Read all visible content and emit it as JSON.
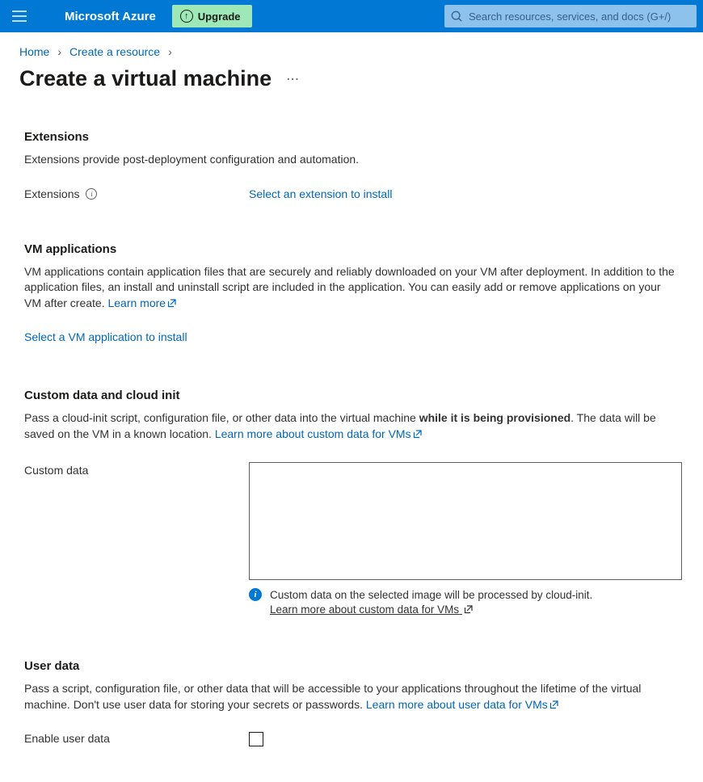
{
  "header": {
    "brand": "Microsoft Azure",
    "upgrade_label": "Upgrade",
    "search_placeholder": "Search resources, services, and docs (G+/)"
  },
  "breadcrumb": {
    "items": [
      "Home",
      "Create a resource"
    ]
  },
  "title": "Create a virtual machine",
  "extensions": {
    "heading": "Extensions",
    "description": "Extensions provide post-deployment configuration and automation.",
    "label": "Extensions",
    "action": "Select an extension to install"
  },
  "vm_apps": {
    "heading": "VM applications",
    "description": "VM applications contain application files that are securely and reliably downloaded on your VM after deployment. In addition to the application files, an install and uninstall script are included in the application. You can easily add or remove applications on your VM after create.",
    "learn_more": "Learn more",
    "action": "Select a VM application to install"
  },
  "custom_data": {
    "heading": "Custom data and cloud init",
    "desc_pre": "Pass a cloud-init script, configuration file, or other data into the virtual machine ",
    "desc_bold": "while it is being provisioned",
    "desc_post": ". The data will be saved on the VM in a known location.",
    "learn_more": "Learn more about custom data for VMs",
    "label": "Custom data",
    "value": "",
    "info_text": "Custom data on the selected image will be processed by cloud-init.",
    "info_link": "Learn more about custom data for VMs"
  },
  "user_data": {
    "heading": "User data",
    "description": "Pass a script, configuration file, or other data that will be accessible to your applications throughout the lifetime of the virtual machine. Don't use user data for storing your secrets or passwords.",
    "learn_more": "Learn more about user data for VMs",
    "enable_label": "Enable user data",
    "enabled": false
  }
}
